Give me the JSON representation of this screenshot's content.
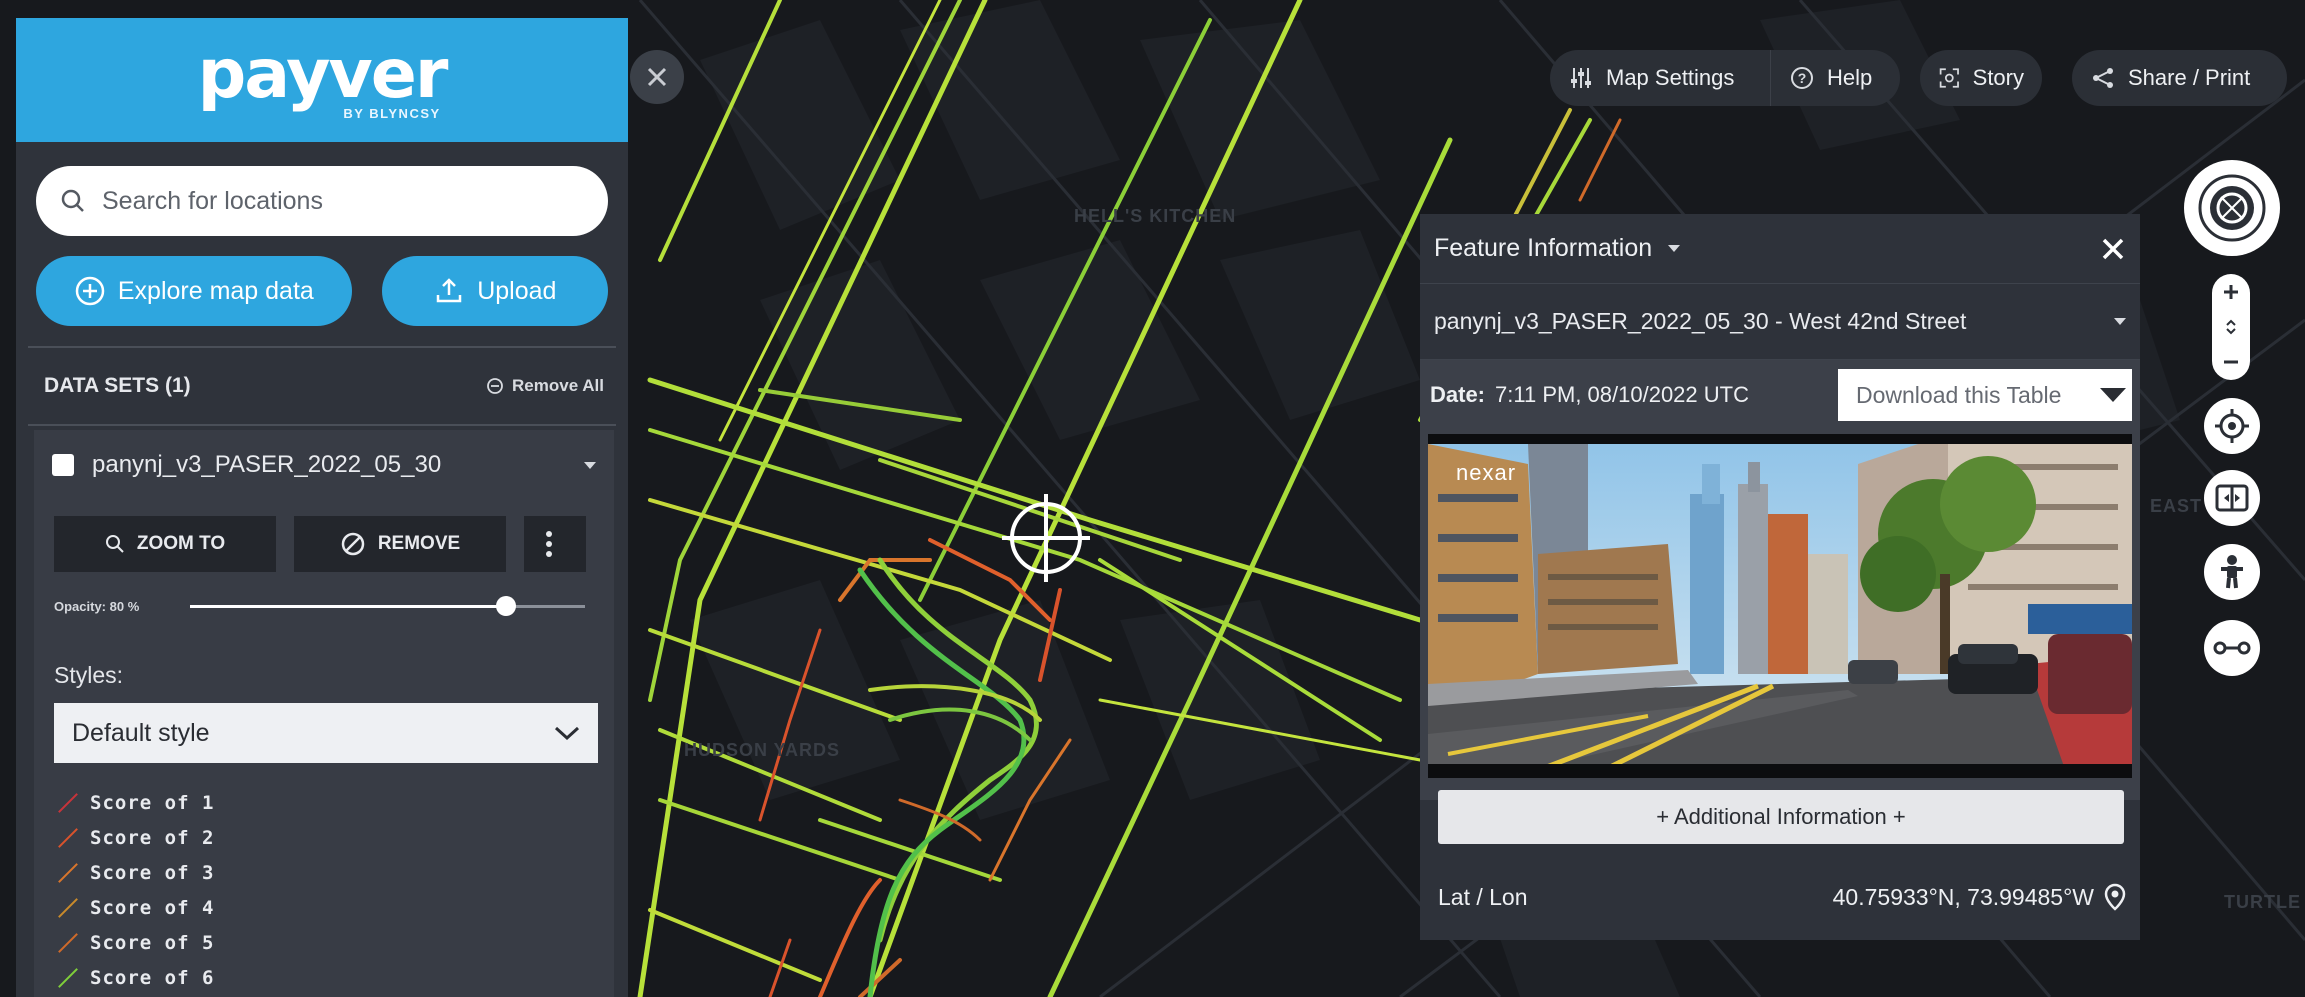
{
  "brand": {
    "name": "payver",
    "sub": "BY BLYNCSY"
  },
  "search": {
    "placeholder": "Search for locations"
  },
  "actions": {
    "explore_label": "Explore map data",
    "upload_label": "Upload"
  },
  "datasets": {
    "title": "DATA SETS (1)",
    "remove_all": "Remove All",
    "item": {
      "name": "panynj_v3_PASER_2022_05_30",
      "zoom_label": "ZOOM TO",
      "remove_label": "REMOVE",
      "opacity_label": "Opacity: 80 %",
      "opacity_value": 0.8,
      "styles_label": "Styles:",
      "style_selected": "Default style",
      "legend": [
        {
          "label": "Score of 1",
          "color": "#c8343a"
        },
        {
          "label": "Score of 2",
          "color": "#d9532c"
        },
        {
          "label": "Score of 3",
          "color": "#d9752c"
        },
        {
          "label": "Score of 4",
          "color": "#c98a2b"
        },
        {
          "label": "Score of 5",
          "color": "#d06a2a"
        },
        {
          "label": "Score of 6",
          "color": "#7fcf3a"
        }
      ]
    }
  },
  "toolbar": {
    "map_settings": "Map Settings",
    "help": "Help",
    "story": "Story",
    "share": "Share / Print"
  },
  "map_labels": [
    "HELL'S KITCHEN",
    "HUDSON YARDS",
    "EAST",
    "TURTLE"
  ],
  "feature": {
    "title": "Feature Information",
    "name": "panynj_v3_PASER_2022_05_30 - West 42nd Street",
    "date_label": "Date:",
    "date_value": "7:11 PM, 08/10/2022 UTC",
    "download_label": "Download this Table",
    "image_brand": "nexar",
    "additional": "+ Additional Information +",
    "latlon_label": "Lat / Lon",
    "latlon_value": "40.75933°N, 73.99485°W"
  },
  "colors": {
    "brand_blue": "#2ea6df",
    "panel_dark": "#2e323a",
    "sidebar": "#2f333b"
  },
  "icons": [
    "search-icon",
    "plus-circle-icon",
    "upload-icon",
    "minus-circle-icon",
    "magnifier-icon",
    "block-icon",
    "kebab-icon",
    "chevron-down-icon",
    "close-icon",
    "sliders-icon",
    "help-icon",
    "story-icon",
    "share-icon",
    "compass-icon",
    "locate-icon",
    "split-view-icon",
    "pegman-icon",
    "route-icon",
    "pin-icon",
    "crosshair-icon"
  ]
}
